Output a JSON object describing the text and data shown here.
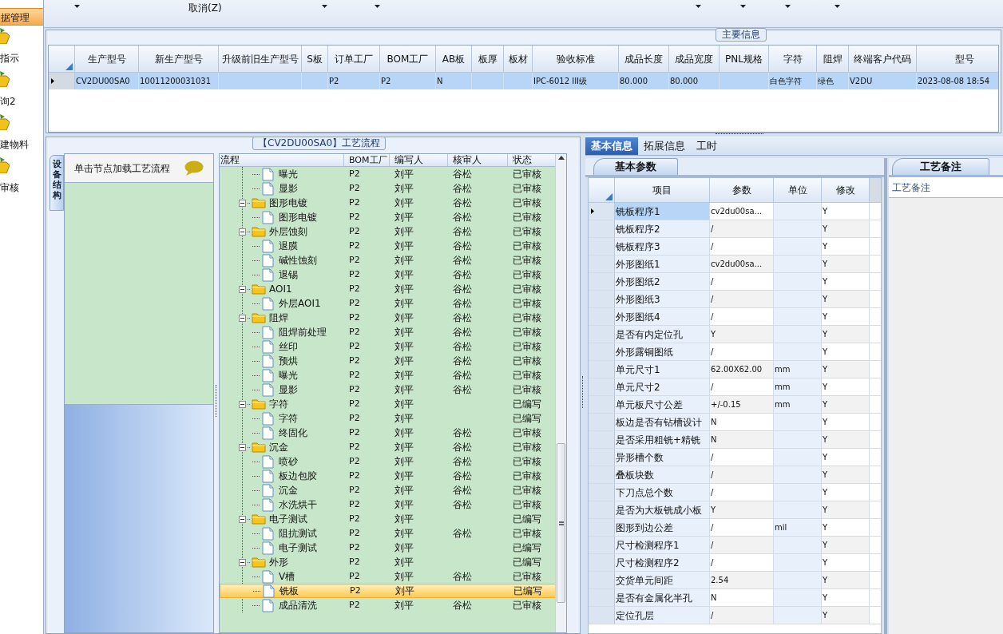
{
  "sidebar": {
    "items": [
      {
        "label": "据管理",
        "selected": true,
        "kind": "header"
      },
      {
        "label": "指示",
        "selected": false,
        "kind": "item"
      },
      {
        "label": "询2",
        "selected": false,
        "kind": "item"
      },
      {
        "label": "建物料",
        "selected": false,
        "kind": "item"
      },
      {
        "label": "审核",
        "selected": false,
        "kind": "item"
      }
    ]
  },
  "toolbar": {
    "cancel": "取消(Z)"
  },
  "main_info": {
    "title": "主要信息",
    "columns": [
      "生产型号",
      "新生产型号",
      "升级前旧生产型号",
      "S板",
      "订单工厂",
      "BOM工厂",
      "AB板",
      "板厚",
      "板材",
      "验收标准",
      "成品长度",
      "成品宽度",
      "PNL规格",
      "字符",
      "阻焊",
      "终端客户代码",
      "型号"
    ],
    "rows": [
      {
        "selected": true,
        "cells": [
          "CV2DU00SA0",
          "10011200031031",
          "",
          "",
          "P2",
          "P2",
          "N",
          "",
          "",
          "IPC-6012 III级",
          "80.000",
          "80.000",
          "",
          "白色字符",
          "绿色",
          "V2DU",
          "2023-08-08 18:54"
        ]
      }
    ]
  },
  "process_flow": {
    "title": "【CV2DU00SA0】工艺流程",
    "side_tab": "设备结构",
    "hint": "单击节点加载工艺流程",
    "columns": [
      "流程",
      "BOM工厂",
      "编写人",
      "核审人",
      "状态"
    ],
    "tree": [
      {
        "kind": "file",
        "name": "曝光",
        "bom": "P2",
        "writer": "刘平",
        "reviewer": "谷松",
        "status": "已审核",
        "selected": false
      },
      {
        "kind": "file",
        "name": "显影",
        "bom": "P2",
        "writer": "刘平",
        "reviewer": "谷松",
        "status": "已审核",
        "selected": false
      },
      {
        "kind": "folder",
        "name": "图形电镀",
        "bom": "P2",
        "writer": "刘平",
        "reviewer": "谷松",
        "status": "已审核",
        "selected": false,
        "expanded": true,
        "children": [
          {
            "kind": "file",
            "name": "图形电镀",
            "bom": "P2",
            "writer": "刘平",
            "reviewer": "谷松",
            "status": "已审核",
            "selected": false
          }
        ]
      },
      {
        "kind": "folder",
        "name": "外层蚀刻",
        "bom": "P2",
        "writer": "刘平",
        "reviewer": "谷松",
        "status": "已审核",
        "selected": false,
        "expanded": true,
        "children": [
          {
            "kind": "file",
            "name": "退膜",
            "bom": "P2",
            "writer": "刘平",
            "reviewer": "谷松",
            "status": "已审核",
            "selected": false
          },
          {
            "kind": "file",
            "name": "碱性蚀刻",
            "bom": "P2",
            "writer": "刘平",
            "reviewer": "谷松",
            "status": "已审核",
            "selected": false
          },
          {
            "kind": "file",
            "name": "退锡",
            "bom": "P2",
            "writer": "刘平",
            "reviewer": "谷松",
            "status": "已审核",
            "selected": false
          }
        ]
      },
      {
        "kind": "folder",
        "name": "AOI1",
        "bom": "P2",
        "writer": "刘平",
        "reviewer": "谷松",
        "status": "已审核",
        "selected": false,
        "expanded": true,
        "children": [
          {
            "kind": "file",
            "name": "外层AOI1",
            "bom": "P2",
            "writer": "刘平",
            "reviewer": "谷松",
            "status": "已审核",
            "selected": false
          }
        ]
      },
      {
        "kind": "folder",
        "name": "阻焊",
        "bom": "P2",
        "writer": "刘平",
        "reviewer": "谷松",
        "status": "已审核",
        "selected": false,
        "expanded": true,
        "children": [
          {
            "kind": "file",
            "name": "阻焊前处理",
            "bom": "P2",
            "writer": "刘平",
            "reviewer": "谷松",
            "status": "已审核",
            "selected": false
          },
          {
            "kind": "file",
            "name": "丝印",
            "bom": "P2",
            "writer": "刘平",
            "reviewer": "谷松",
            "status": "已审核",
            "selected": false
          },
          {
            "kind": "file",
            "name": "预烘",
            "bom": "P2",
            "writer": "刘平",
            "reviewer": "谷松",
            "status": "已审核",
            "selected": false
          },
          {
            "kind": "file",
            "name": "曝光",
            "bom": "P2",
            "writer": "刘平",
            "reviewer": "谷松",
            "status": "已审核",
            "selected": false
          },
          {
            "kind": "file",
            "name": "显影",
            "bom": "P2",
            "writer": "刘平",
            "reviewer": "谷松",
            "status": "已审核",
            "selected": false
          }
        ]
      },
      {
        "kind": "folder",
        "name": "字符",
        "bom": "P2",
        "writer": "刘平",
        "status": "已编写",
        "selected": false,
        "expanded": true,
        "children": [
          {
            "kind": "file",
            "name": "字符",
            "bom": "P2",
            "writer": "刘平",
            "status": "已编写",
            "selected": false
          },
          {
            "kind": "file",
            "name": "终固化",
            "bom": "P2",
            "writer": "刘平",
            "reviewer": "谷松",
            "status": "已审核",
            "selected": false
          }
        ]
      },
      {
        "kind": "folder",
        "name": "沉金",
        "bom": "P2",
        "writer": "刘平",
        "reviewer": "谷松",
        "status": "已审核",
        "selected": false,
        "expanded": true,
        "children": [
          {
            "kind": "file",
            "name": "喷砂",
            "bom": "P2",
            "writer": "刘平",
            "reviewer": "谷松",
            "status": "已审核",
            "selected": false
          },
          {
            "kind": "file",
            "name": "板边包胶",
            "bom": "P2",
            "writer": "刘平",
            "reviewer": "谷松",
            "status": "已审核",
            "selected": false
          },
          {
            "kind": "file",
            "name": "沉金",
            "bom": "P2",
            "writer": "刘平",
            "reviewer": "谷松",
            "status": "已审核",
            "selected": false
          },
          {
            "kind": "file",
            "name": "水洗烘干",
            "bom": "P2",
            "writer": "刘平",
            "reviewer": "谷松",
            "status": "已审核",
            "selected": false
          }
        ]
      },
      {
        "kind": "folder",
        "name": "电子测试",
        "bom": "P2",
        "writer": "刘平",
        "status": "已编写",
        "selected": false,
        "expanded": true,
        "children": [
          {
            "kind": "file",
            "name": "阻抗测试",
            "bom": "P2",
            "writer": "刘平",
            "reviewer": "谷松",
            "status": "已审核",
            "selected": false
          },
          {
            "kind": "file",
            "name": "电子测试",
            "bom": "P2",
            "writer": "刘平",
            "status": "已编写",
            "selected": false
          }
        ]
      },
      {
        "kind": "folder",
        "name": "外形",
        "bom": "P2",
        "writer": "刘平",
        "status": "已编写",
        "selected": false,
        "expanded": true,
        "children": [
          {
            "kind": "file",
            "name": "V槽",
            "bom": "P2",
            "writer": "刘平",
            "reviewer": "谷松",
            "status": "已审核",
            "selected": false
          },
          {
            "kind": "file",
            "name": "铣板",
            "bom": "P2",
            "writer": "刘平",
            "status": "已编写",
            "selected": true
          },
          {
            "kind": "file",
            "name": "成品清洗",
            "bom": "P2",
            "writer": "刘平",
            "reviewer": "谷松",
            "status": "已审核",
            "selected": false
          }
        ]
      }
    ]
  },
  "detail_tabs": [
    {
      "label": "基本信息",
      "selected": true
    },
    {
      "label": "拓展信息",
      "selected": false
    },
    {
      "label": "工时",
      "selected": false
    }
  ],
  "basic_params": {
    "tab": "基本参数",
    "columns": [
      "项目",
      "参数",
      "单位",
      "修改"
    ],
    "rows": [
      {
        "selected": true,
        "cells": [
          "铣板程序1",
          "cv2du00sa...",
          "",
          "Y"
        ]
      },
      {
        "selected": false,
        "cells": [
          "铣板程序2",
          "/",
          "",
          "Y"
        ]
      },
      {
        "selected": false,
        "cells": [
          "铣板程序3",
          "/",
          "",
          "Y"
        ]
      },
      {
        "selected": false,
        "cells": [
          "外形图纸1",
          "cv2du00sa...",
          "",
          "Y"
        ]
      },
      {
        "selected": false,
        "cells": [
          "外形图纸2",
          "/",
          "",
          "Y"
        ]
      },
      {
        "selected": false,
        "cells": [
          "外形图纸3",
          "/",
          "",
          "Y"
        ]
      },
      {
        "selected": false,
        "cells": [
          "外形图纸4",
          "/",
          "",
          "Y"
        ]
      },
      {
        "selected": false,
        "cells": [
          "是否有内定位孔",
          "Y",
          "",
          "Y"
        ]
      },
      {
        "selected": false,
        "cells": [
          "外形露铜图纸",
          "/",
          "",
          "Y"
        ]
      },
      {
        "selected": false,
        "cells": [
          "单元尺寸1",
          "62.00X62.00",
          "mm",
          "Y"
        ]
      },
      {
        "selected": false,
        "cells": [
          "单元尺寸2",
          "/",
          "mm",
          "Y"
        ]
      },
      {
        "selected": false,
        "cells": [
          "单元板尺寸公差",
          "+/-0.15",
          "mm",
          "Y"
        ]
      },
      {
        "selected": false,
        "cells": [
          "板边是否有钻槽设计",
          "N",
          "",
          "Y"
        ]
      },
      {
        "selected": false,
        "cells": [
          "是否采用粗铣+精铣",
          "N",
          "",
          "Y"
        ]
      },
      {
        "selected": false,
        "cells": [
          "异形槽个数",
          "/",
          "",
          "Y"
        ]
      },
      {
        "selected": false,
        "cells": [
          "叠板块数",
          "/",
          "",
          "Y"
        ]
      },
      {
        "selected": false,
        "cells": [
          "下刀点总个数",
          "/",
          "",
          "Y"
        ]
      },
      {
        "selected": false,
        "cells": [
          "是否为大板铣成小板",
          "Y",
          "",
          "Y"
        ]
      },
      {
        "selected": false,
        "cells": [
          "图形到边公差",
          "/",
          "mil",
          "Y"
        ]
      },
      {
        "selected": false,
        "cells": [
          "尺寸检测程序1",
          "/",
          "",
          "Y"
        ]
      },
      {
        "selected": false,
        "cells": [
          "尺寸检测程序2",
          "/",
          "",
          "Y"
        ]
      },
      {
        "selected": false,
        "cells": [
          "交货单元间距",
          "2.54",
          "",
          "Y"
        ]
      },
      {
        "selected": false,
        "cells": [
          "是否有金属化半孔",
          "N",
          "",
          "Y"
        ]
      },
      {
        "selected": false,
        "cells": [
          "定位孔层",
          "/",
          "",
          "Y"
        ]
      }
    ]
  },
  "remarks": {
    "tab": "工艺备注",
    "label": "工艺备注"
  }
}
